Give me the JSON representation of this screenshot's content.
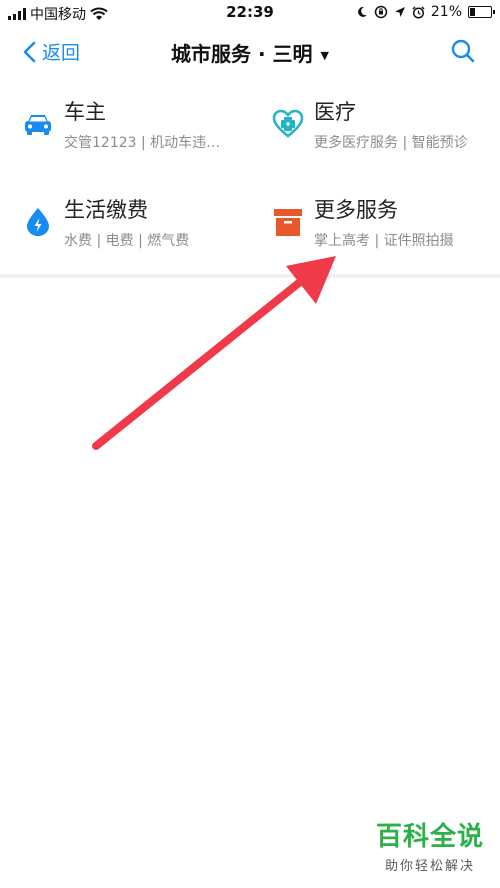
{
  "status_bar": {
    "carrier": "中国移动",
    "time": "22:39",
    "battery": "21%",
    "battery_level": 0.21,
    "icons": [
      "signal-icon",
      "wifi-icon",
      "moon-icon",
      "lock-rotation-icon",
      "location-icon",
      "alarm-icon",
      "battery-icon"
    ]
  },
  "nav": {
    "back_label": "返回",
    "title": "城市服务 · 三明",
    "caret": "▼",
    "search_icon": "search-icon"
  },
  "services": [
    {
      "name": "车主",
      "desc": "交管12123 | 机动车违…",
      "icon": "car-icon",
      "color": "#1a8cf0"
    },
    {
      "name": "医疗",
      "desc": "更多医疗服务 | 智能预诊",
      "icon": "medical-heart-icon",
      "color": "#22b5c6"
    },
    {
      "name": "生活缴费",
      "desc": "水费 | 电费 | 燃气费",
      "icon": "water-drop-icon",
      "color": "#1a8cf0"
    },
    {
      "name": "更多服务",
      "desc": "掌上高考 | 证件照拍摄",
      "icon": "box-icon",
      "color": "#e8582a"
    }
  ],
  "annotation": {
    "color": "#f03a4a"
  },
  "watermark": {
    "title": "百科全说",
    "subtitle": "助你轻松解决"
  }
}
